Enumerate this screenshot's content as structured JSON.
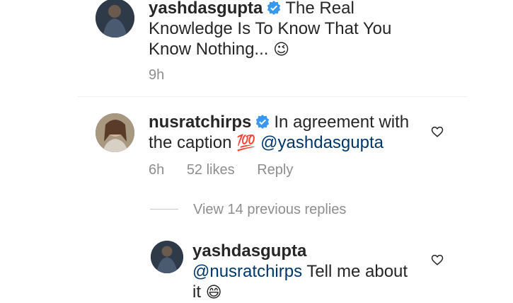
{
  "comment1": {
    "username": "yashdasgupta",
    "text_line1": "The Real",
    "text_line2": "Knowledge Is To Know That You",
    "text_line3": "Know Nothing...",
    "emoji": "😉",
    "time": "9h"
  },
  "comment2": {
    "username": "nusratchirps",
    "text_line1": "In agreement with",
    "text_line2_prefix": "the caption",
    "emoji": "💯",
    "mention": "@yashdasgupta",
    "time": "6h",
    "likes": "52 likes",
    "reply_label": "Reply"
  },
  "view_replies": "View 14 previous replies",
  "reply1": {
    "username": "yashdasgupta",
    "mention": "@nusratchirps",
    "text": "Tell me about",
    "text_line3": "it",
    "emoji": "😄"
  },
  "colors": {
    "verified": "#3897f0",
    "mention": "#00376b",
    "meta": "#8e8e8e"
  }
}
